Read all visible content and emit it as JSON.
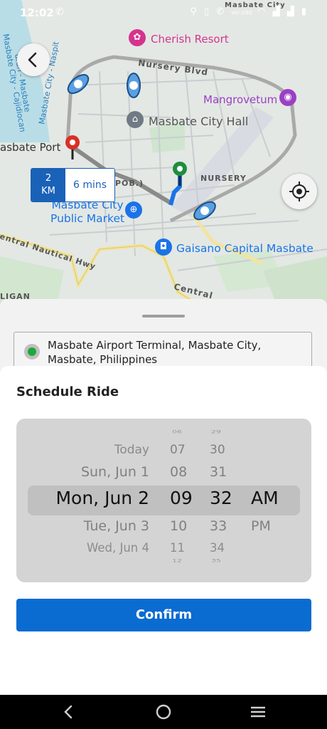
{
  "status_bar": {
    "time": "12:02",
    "icons_left": [
      "whatsapp-icon"
    ],
    "icons_right": [
      "location-icon",
      "vibrate-icon",
      "wifi-call-icon",
      "volte-icon",
      "wifi-icon",
      "signal-icon",
      "signal-icon",
      "battery-icon"
    ],
    "volte_text": "Vo) LTE2"
  },
  "map": {
    "labels": {
      "cherish_resort": "Cherish Resort",
      "mangrovetum": "Mangrovetum",
      "city_hall": "Masbate City Hall",
      "public_market_line1": "Masbate City",
      "public_market_line2": "Public Market",
      "gaisano": "Gaisano Capital Masbate",
      "port": "asbate Port",
      "nursery_blvd": "Nursery Blvd",
      "nursery": "NURSERY",
      "pob": "POB.)",
      "central_nautical": "entral Nautical Hwy",
      "central": "Central",
      "ligan": "LIGAN",
      "masbate_top": "Masbate City",
      "water_1": "Masbate City - Cajidiocan",
      "water_2": "uran - Masbate",
      "water_3": "Masbate City - Naspit"
    },
    "distance_km_line1": "2",
    "distance_km_line2": "KM",
    "duration": "6 mins",
    "route_color": "#1a73e8",
    "pickup_pin_color": "#1e8e3e",
    "dropoff_pin_color": "#d93025"
  },
  "sheet": {
    "pickup_address": "Masbate Airport Terminal, Masbate City, Masbate, Philippines"
  },
  "schedule": {
    "title": "Schedule Ride",
    "dates": {
      "minus2": "Today",
      "minus1": "Sun, Jun 1",
      "selected": "Mon, Jun 2",
      "plus1": "Tue, Jun 3",
      "plus2": "Wed, Jun 4"
    },
    "hours": {
      "minus3": "06",
      "minus2": "07",
      "minus1": "08",
      "selected": "09",
      "plus1": "10",
      "plus2": "11",
      "plus3": "12"
    },
    "minutes": {
      "minus3": "29",
      "minus2": "30",
      "minus1": "31",
      "selected": "32",
      "plus1": "33",
      "plus2": "34",
      "plus3": "35"
    },
    "ampm": {
      "selected": "AM",
      "plus1": "PM"
    },
    "confirm_label": "Confirm"
  },
  "nav_bar": {
    "buttons": [
      "back-nav",
      "home-nav",
      "recents-nav"
    ]
  }
}
